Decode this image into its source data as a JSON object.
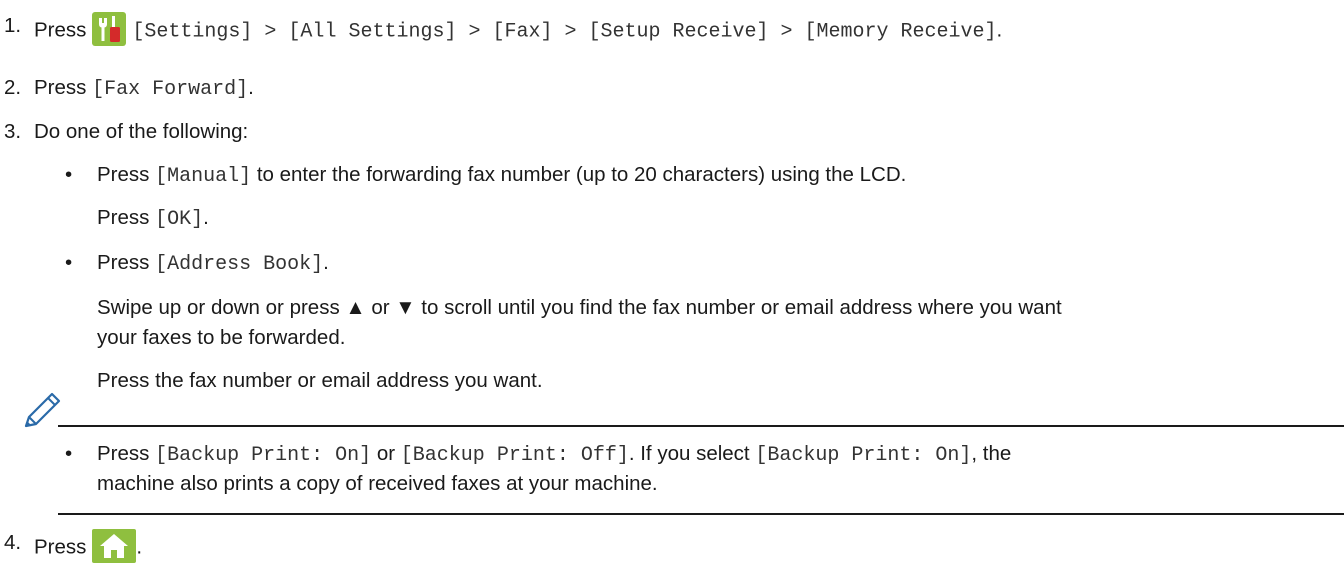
{
  "steps": [
    {
      "number": "1.",
      "press": "Press",
      "icon": "settings-tools-icon",
      "path": "[Settings] > [All Settings] > [Fax] > [Setup Receive] > [Memory Receive]",
      "period": "."
    },
    {
      "number": "2.",
      "press": "Press",
      "code": "[Fax Forward]",
      "period": "."
    },
    {
      "number": "3.",
      "text": "Do one of the following:",
      "options": [
        {
          "bullet": "•",
          "press": "Press",
          "code": "[Manual]",
          "rest": "to enter the forwarding fax number (up to 20 characters) using the LCD.",
          "sub_press": "Press",
          "sub_code": "[OK]",
          "sub_period": "."
        },
        {
          "bullet": "•",
          "press": "Press",
          "code": "[Address Book]",
          "period": ".",
          "para1_line1": "Swipe up or down or press ▲ or ▼ to scroll until you find the fax number or email address where you want",
          "para1_line2": "your faxes to be forwarded.",
          "para2": "Press the fax number or email address you want."
        }
      ]
    },
    {
      "number": "4.",
      "press": "Press",
      "icon": "home-icon",
      "period": "."
    }
  ],
  "note": {
    "icon": "pencil-note-icon",
    "bullet": "•",
    "press": "Press",
    "code1": "[Backup Print: On]",
    "or": "or",
    "code2": "[Backup Print: Off]",
    "mid": ". If you select",
    "code3": "[Backup Print: On]",
    "comma": ", the",
    "line2": "machine also prints a copy of received faxes at your machine."
  },
  "colors": {
    "settings_icon_bg": "#8fbf3f",
    "settings_icon_red": "#d42a2a",
    "home_icon_bg": "#8fbf3f"
  }
}
